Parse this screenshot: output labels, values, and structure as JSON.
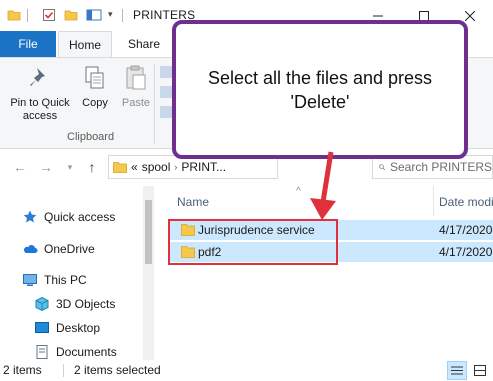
{
  "window": {
    "title": "PRINTERS"
  },
  "ribbon": {
    "tabs": [
      "File",
      "Home",
      "Share"
    ],
    "clipboard": {
      "pin_label": "Pin to Quick access",
      "copy_label": "Copy",
      "paste_label": "Paste",
      "group_label": "Clipboard"
    }
  },
  "address": {
    "overflow": "«",
    "path_1": "spool",
    "path_2": "PRINT...",
    "search_placeholder": "Search PRINTERS"
  },
  "nav": {
    "items": [
      "Quick access",
      "OneDrive",
      "This PC",
      "3D Objects",
      "Desktop",
      "Documents"
    ]
  },
  "filelist": {
    "col_name": "Name",
    "col_date": "Date modi",
    "rows": [
      {
        "name": "Jurisprudence service",
        "date": "4/17/2020"
      },
      {
        "name": "pdf2",
        "date": "4/17/2020"
      }
    ]
  },
  "status": {
    "count": "2 items",
    "selected": "2 items selected"
  },
  "callout": {
    "text": "Select all the files and press 'Delete'"
  },
  "colors": {
    "accent": "#1a73c5",
    "selection": "#cce8ff",
    "highlight": "#e0303a",
    "callout_border": "#6e2f8f"
  }
}
